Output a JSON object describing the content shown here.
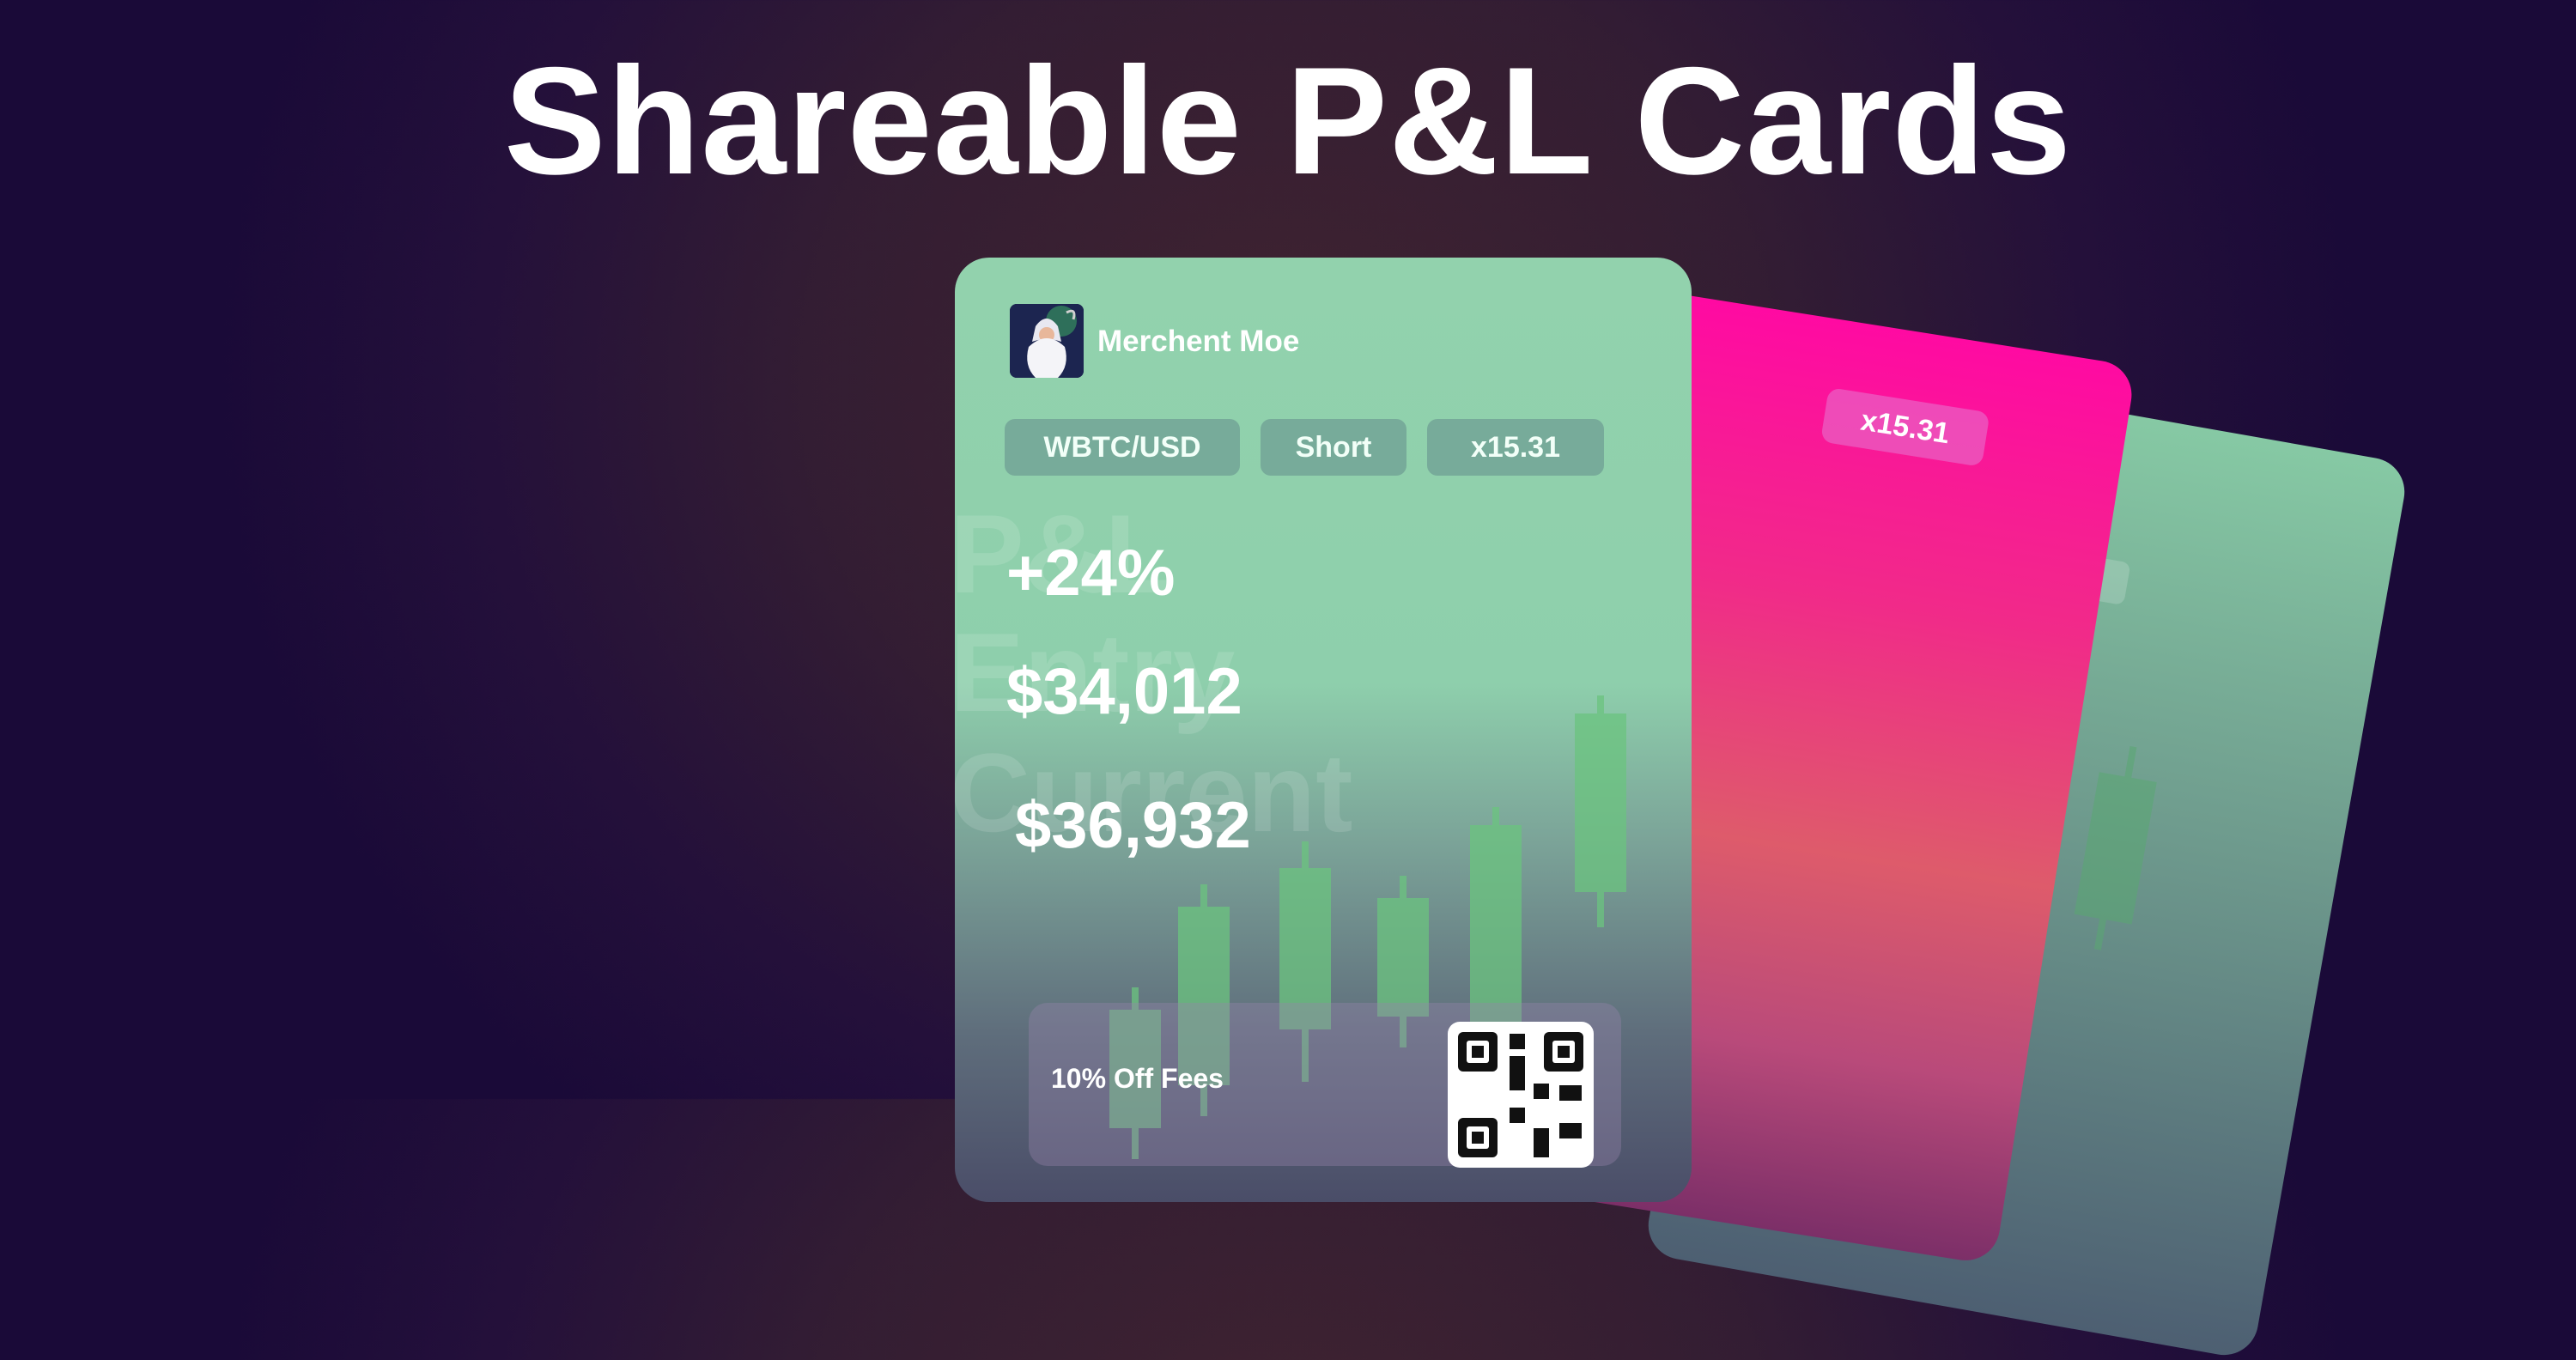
{
  "headline": "Shareable P&L Cards",
  "front_card": {
    "brand_name": "Merchent Moe",
    "tags": [
      "WBTC/USD",
      "Short",
      "x15.31"
    ],
    "ghost_labels": [
      "P&L",
      "Entry",
      "Current"
    ],
    "pnl": "+24%",
    "entry_price": "$34,012",
    "current_price": "$36,932",
    "promo_text": "10% Off Fees"
  },
  "middle_card": {
    "leverage": "x15.31"
  },
  "colors": {
    "front_card_green": "#92d2ad",
    "middle_card_pink": "#ff0aa2",
    "candle_green": "#5fbf79"
  },
  "icons": [
    "wizard-avatar-icon",
    "qr-code-icon"
  ]
}
